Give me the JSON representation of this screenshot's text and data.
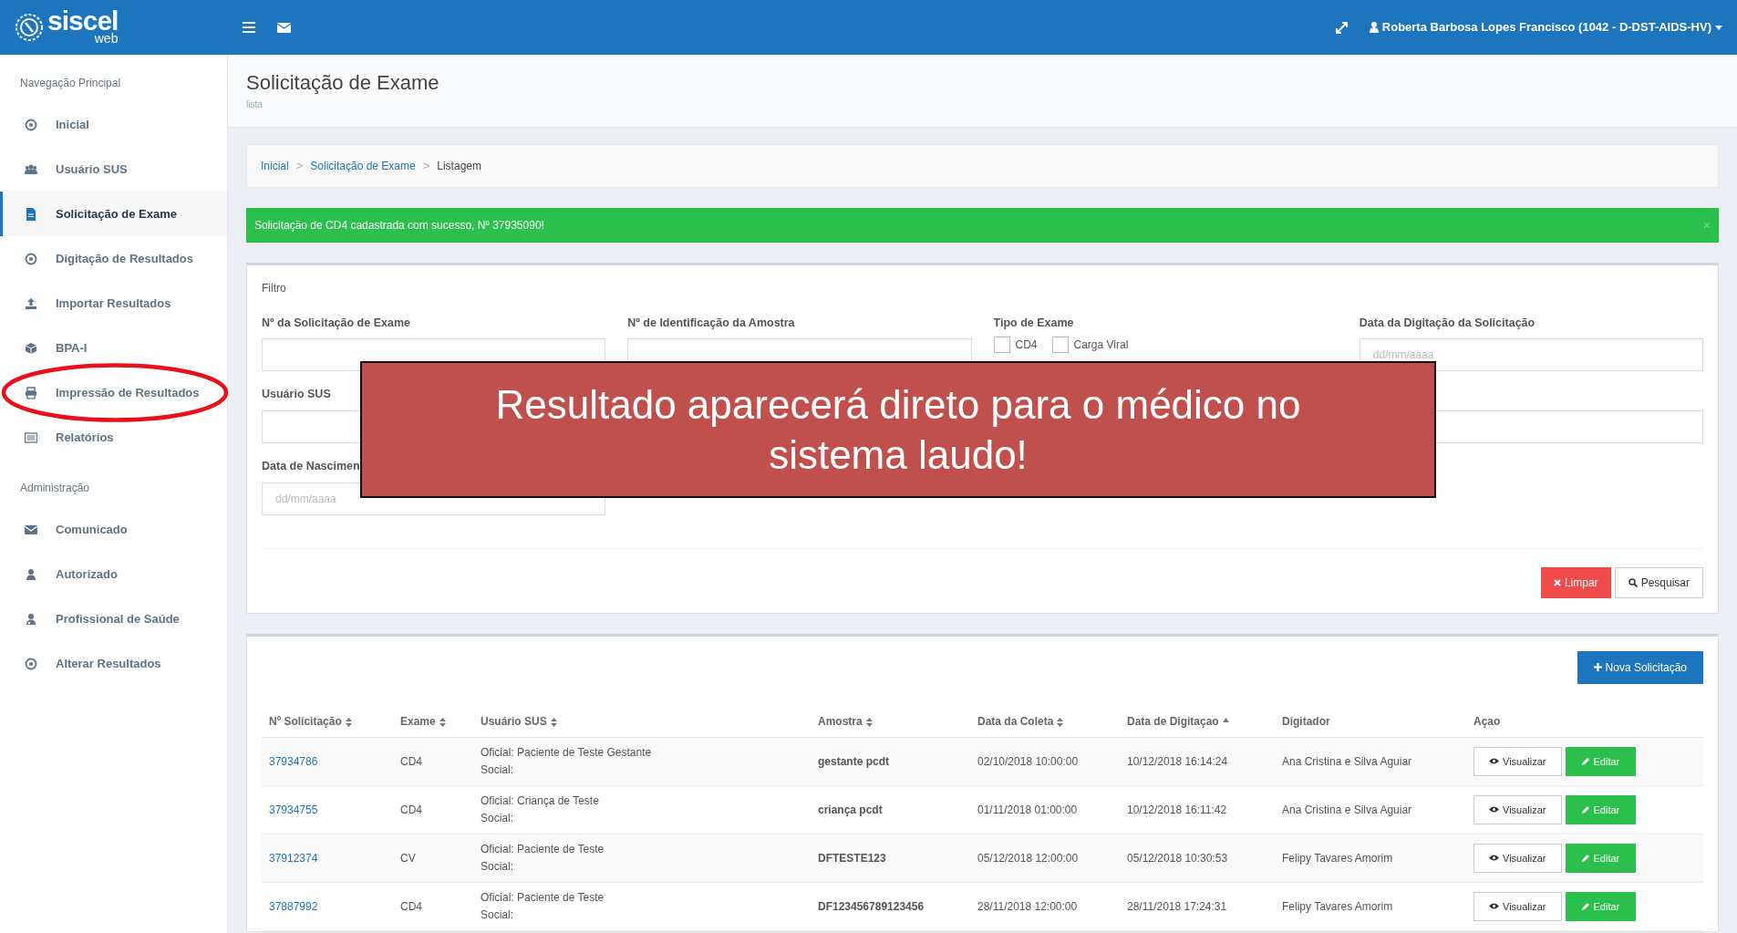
{
  "topbar": {
    "logo": "siscel",
    "logo_sub": "web",
    "user": "Roberta Barbosa Lopes Francisco (1042 - D-DST-AIDS-HV)"
  },
  "sidebar": {
    "sections": [
      {
        "title": "Navegação Principal",
        "items": [
          {
            "label": "Inicial",
            "selected": false,
            "circled": false
          },
          {
            "label": "Usuário SUS",
            "selected": false,
            "circled": false
          },
          {
            "label": "Solicitação de Exame",
            "selected": true,
            "circled": false
          },
          {
            "label": "Digitação de Resultados",
            "selected": false,
            "circled": false
          },
          {
            "label": "Importar Resultados",
            "selected": false,
            "circled": false
          },
          {
            "label": "BPA-I",
            "selected": false,
            "circled": false
          },
          {
            "label": "Impressão de Resultados",
            "selected": false,
            "circled": true
          },
          {
            "label": "Relatórios",
            "selected": false,
            "circled": false
          }
        ]
      },
      {
        "title": "Administração",
        "items": [
          {
            "label": "Comunicado",
            "selected": false,
            "circled": false
          },
          {
            "label": "Autorizado",
            "selected": false,
            "circled": false
          },
          {
            "label": "Profissional de Saúde",
            "selected": false,
            "circled": false
          },
          {
            "label": "Alterar Resultados",
            "selected": false,
            "circled": false
          }
        ]
      }
    ]
  },
  "page": {
    "title": "Solicitação de Exame",
    "subtitle": "lista"
  },
  "breadcrumb": [
    {
      "label": "Inicial"
    },
    {
      "separator": ">",
      "label": "Solicitação de Exame"
    },
    {
      "separator": ">",
      "label": "Listagem"
    }
  ],
  "alert": {
    "text": "Solicitação de CD4 cadastrada com sucesso, Nº 37935090!",
    "close": "×"
  },
  "filter": {
    "title": "Filtro",
    "fields": [
      {
        "kind": "input",
        "label": "Nº da Solicitação de Exame"
      },
      {
        "kind": "input",
        "label": "Nº de Identificação da Amostra"
      },
      {
        "kind": "checks",
        "label": "Tipo de Exame",
        "options": [
          {
            "label": "CD4",
            "checked": false
          },
          {
            "label": "Carga Viral",
            "checked": false
          }
        ]
      },
      {
        "kind": "input",
        "label": "Data da Digitação da Solicitação",
        "placeholder": "dd/mm/aaaa"
      },
      {
        "kind": "input",
        "label": "Usuário SUS"
      },
      {
        "kind": "empty"
      },
      {
        "kind": "empty"
      },
      {
        "kind": "input"
      },
      {
        "kind": "input",
        "label": "Data de Nascimen",
        "placeholder": "dd/mm/aaaa"
      }
    ],
    "buttons": [
      {
        "kind": "clear",
        "label": "Limpar"
      },
      {
        "kind": "search",
        "label": "Pesquisar"
      }
    ]
  },
  "callout": {
    "text": "Resultado aparecerá direto para o médico no sistema laudo!"
  },
  "table": {
    "new_button": "Nova Solicitação",
    "columns": [
      {
        "label": "Nº Solicitação",
        "sortable": true,
        "sorted_ascending": false
      },
      {
        "label": "Exame",
        "sortable": true,
        "sorted_ascending": false
      },
      {
        "label": "Usuário SUS",
        "sortable": true,
        "sorted_ascending": false
      },
      {
        "label": "Amostra",
        "sortable": true,
        "sorted_ascending": false
      },
      {
        "label": "Data da Coleta",
        "sortable": true,
        "sorted_ascending": false
      },
      {
        "label": "Data de Digitaçao",
        "sortable": true,
        "sorted_ascending": true
      },
      {
        "label": "Digitador",
        "sortable": false
      },
      {
        "label": "Açao",
        "sortable": false
      }
    ],
    "rows": [
      {
        "numero": "37934786",
        "exame": "CD4",
        "usuario": [
          "Oficial: Paciente de Teste Gestante",
          "Social:"
        ],
        "amostra": "gestante pcdt",
        "coleta": "02/10/2018 10:00:00",
        "digitacao": "10/12/2018 16:14:24",
        "digitador": "Ana Cristina e Silva Aguiar",
        "actions": [
          "Visualizar",
          "Editar"
        ]
      },
      {
        "numero": "37934755",
        "exame": "CD4",
        "usuario": [
          "Oficial: Criança de Teste",
          "Social:"
        ],
        "amostra": "criança pcdt",
        "coleta": "01/11/2018 01:00:00",
        "digitacao": "10/12/2018 16:11:42",
        "digitador": "Ana Cristina e Silva Aguiar",
        "actions": [
          "Visualizar",
          "Editar"
        ]
      },
      {
        "numero": "37912374",
        "exame": "CV",
        "usuario": [
          "Oficial: Paciente de Teste",
          "Social:"
        ],
        "amostra": "DFTESTE123",
        "coleta": "05/12/2018 12:00:00",
        "digitacao": "05/12/2018 10:30:53",
        "digitador": "Felipy Tavares Amorim",
        "actions": [
          "Visualizar",
          "Editar"
        ]
      },
      {
        "numero": "37887992",
        "exame": "CD4",
        "usuario": [
          "Oficial: Paciente de Teste",
          "Social:"
        ],
        "amostra": "DF123456789123456",
        "coleta": "28/11/2018 12:00:00",
        "digitacao": "28/11/2018 17:24:31",
        "digitador": "Felipy Tavares Amorim",
        "actions": [
          "Visualizar",
          "Editar"
        ]
      }
    ]
  }
}
